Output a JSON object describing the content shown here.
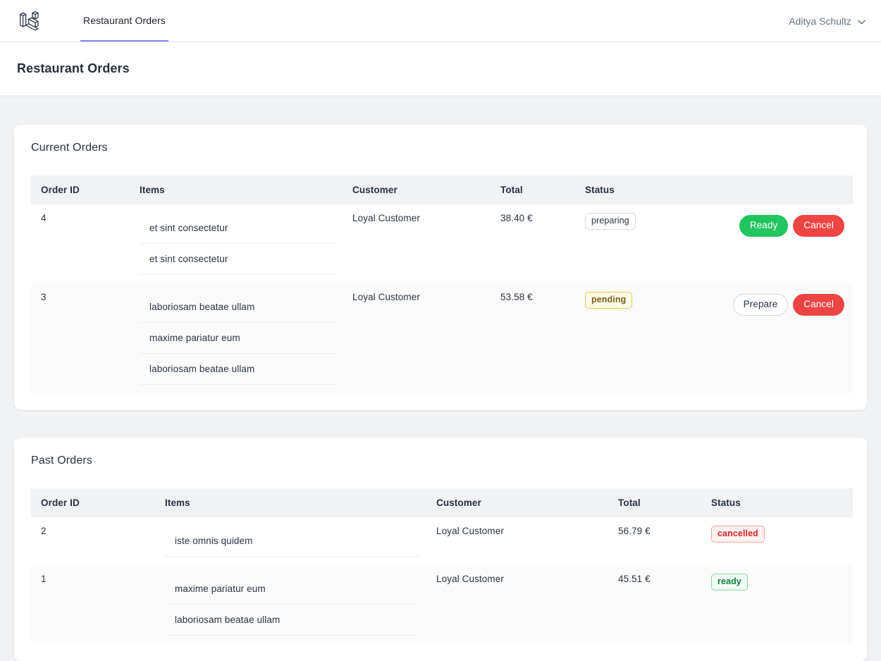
{
  "brand": {
    "icon": "laravel-logo-icon"
  },
  "nav": {
    "links": [
      {
        "label": "Restaurant Orders",
        "active": true
      }
    ],
    "user": {
      "name": "Aditya Schultz",
      "icon": "chevron-down-icon"
    }
  },
  "header": {
    "title": "Restaurant Orders"
  },
  "colors": {
    "page_bg": "#f1f2f4",
    "card_bg": "#ffffff",
    "accent": "#7b86f2",
    "text": "#26303f",
    "thead_bg": "#f1f2f4",
    "stripe_bg": "#fbfbfb",
    "green": "#22c55e",
    "red": "#ef4444",
    "pending_yellow": "#fefce8",
    "ready_green": "#f0fdf4",
    "cancelled_red": "#fef2f2"
  },
  "current_orders": {
    "title": "Current Orders",
    "columns": [
      "Order ID",
      "Items",
      "Customer",
      "Total",
      "Status",
      ""
    ],
    "rows": [
      {
        "id": "4",
        "items": [
          "et sint consectetur",
          "et sint consectetur"
        ],
        "customer": "Loyal Customer",
        "total": "38.40 €",
        "status": "preparing",
        "status_kind": "preparing",
        "actions": [
          {
            "label": "Ready",
            "kind": "ready"
          },
          {
            "label": "Cancel",
            "kind": "cancel"
          }
        ]
      },
      {
        "id": "3",
        "items": [
          "laboriosam beatae ullam",
          "maxime pariatur eum",
          "laboriosam beatae ullam"
        ],
        "customer": "Loyal Customer",
        "total": "53.58 €",
        "status": "pending",
        "status_kind": "pending",
        "actions": [
          {
            "label": "Prepare",
            "kind": "prepare"
          },
          {
            "label": "Cancel",
            "kind": "cancel"
          }
        ]
      }
    ]
  },
  "past_orders": {
    "title": "Past Orders",
    "columns": [
      "Order ID",
      "Items",
      "Customer",
      "Total",
      "Status"
    ],
    "rows": [
      {
        "id": "2",
        "items": [
          "iste omnis quidem"
        ],
        "customer": "Loyal Customer",
        "total": "56.79 €",
        "status": "cancelled",
        "status_kind": "cancelled"
      },
      {
        "id": "1",
        "items": [
          "maxime pariatur eum",
          "laboriosam beatae ullam"
        ],
        "customer": "Loyal Customer",
        "total": "45.51 €",
        "status": "ready",
        "status_kind": "ready"
      }
    ]
  }
}
